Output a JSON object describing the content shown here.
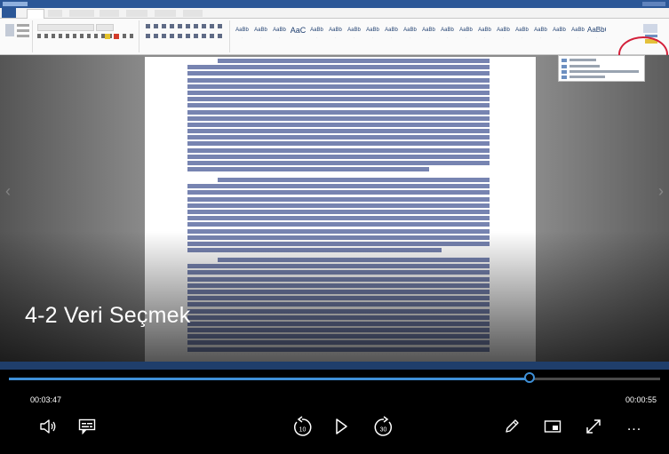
{
  "video": {
    "chapter_title": "4-2 Veri Seçmek",
    "elapsed": "00:03:47",
    "remaining": "00:00:55",
    "progress": 0.8
  },
  "controls": {
    "volume_icon": "volume-icon",
    "subtitles_icon": "subtitles-icon",
    "rewind_label": "10",
    "forward_label": "30",
    "play_icon": "play-icon",
    "pen_icon": "pen-icon",
    "miniview_icon": "miniview-icon",
    "fullscreen_icon": "fullscreen-icon",
    "more_label": "..."
  },
  "colors": {
    "accent": "#3e8fd6",
    "word_blue": "#2b5797",
    "highlight_circle": "#d3203a"
  }
}
